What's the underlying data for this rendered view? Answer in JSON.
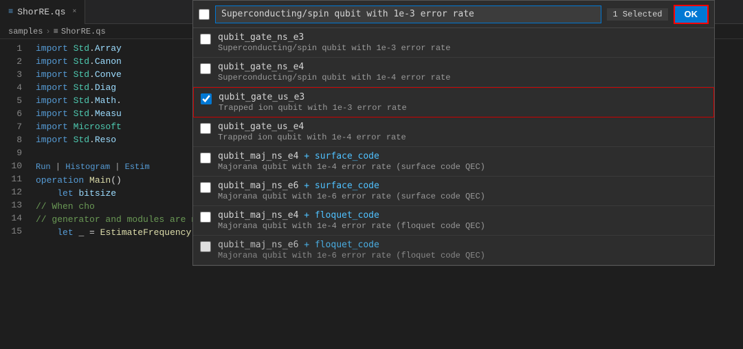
{
  "tab": {
    "icon": "≡",
    "label": "ShorRE.qs",
    "close": "×"
  },
  "breadcrumb": {
    "part1": "samples",
    "sep": "›",
    "icon": "≡",
    "part2": "ShorRE.qs"
  },
  "lines": [
    {
      "num": "1",
      "code": "import_Std.Array"
    },
    {
      "num": "2",
      "code": "import_Std.Canon"
    },
    {
      "num": "3",
      "code": "import_Std.Convert"
    },
    {
      "num": "4",
      "code": "import_Std.Diagnostics"
    },
    {
      "num": "5",
      "code": "import_Std.Math."
    },
    {
      "num": "6",
      "code": "import_Std.Measurement"
    },
    {
      "num": "7",
      "code": "import_Microsoft."
    },
    {
      "num": "8",
      "code": "import_Std.ResourceEstimation"
    },
    {
      "num": "9",
      "code": ""
    },
    {
      "num": "10",
      "code": "run_histogram_estimation"
    },
    {
      "num": "11",
      "code": "operation_Main()"
    },
    {
      "num": "12",
      "code": "let_bitsize"
    },
    {
      "num": "13",
      "code": "comment_when_choosing"
    },
    {
      "num": "14",
      "code": "comment_generator_modules"
    },
    {
      "num": "15",
      "code": "let___EstimateFrequency"
    }
  ],
  "dropdown": {
    "header_checkbox_checked": false,
    "search_placeholder": "Superconducting/spin qubit with 1e-3 error rate",
    "search_value": "Superconducting/spin qubit with 1e-3 error rate",
    "selected_badge": "1 Selected",
    "ok_label": "OK",
    "items": [
      {
        "id": "qubit_gate_ns_e3",
        "title": "qubit_gate_ns_e3",
        "desc": "Superconducting/spin qubit with 1e-3 error rate",
        "checked": false,
        "selected": false
      },
      {
        "id": "qubit_gate_ns_e4",
        "title": "qubit_gate_ns_e4",
        "desc": "Superconducting/spin qubit with 1e-4 error rate",
        "checked": false,
        "selected": false
      },
      {
        "id": "qubit_gate_us_e3",
        "title": "qubit_gate_us_e3",
        "desc": "Trapped ion qubit with 1e-3 error rate",
        "checked": true,
        "selected": true
      },
      {
        "id": "qubit_gate_us_e4",
        "title": "qubit_gate_us_e4",
        "desc": "Trapped ion qubit with 1e-4 error rate",
        "checked": false,
        "selected": false
      },
      {
        "id": "qubit_maj_ns_e4_surface",
        "title_pre": "qubit_maj_ns_e4",
        "title_highlight": " + surface_code",
        "desc": "Majorana qubit with 1e-4 error rate (surface code QEC)",
        "checked": false,
        "selected": false
      },
      {
        "id": "qubit_maj_ns_e6_surface",
        "title_pre": "qubit_maj_ns_e6",
        "title_highlight": " + surface_code",
        "desc": "Majorana qubit with 1e-6 error rate (surface code QEC)",
        "checked": false,
        "selected": false
      },
      {
        "id": "qubit_maj_ns_e4_floquet",
        "title_pre": "qubit_maj_ns_e4",
        "title_highlight": " + floquet_code",
        "desc": "Majorana qubit with 1e-4 error rate (floquet code QEC)",
        "checked": false,
        "selected": false
      },
      {
        "id": "qubit_maj_ns_e6_floquet",
        "title_pre": "qubit_maj_ns_e6",
        "title_highlight": " + floquet_code",
        "desc": "Majorana qubit with 1e-6 error rate (floquet code QEC)",
        "checked": false,
        "selected": false
      }
    ]
  }
}
